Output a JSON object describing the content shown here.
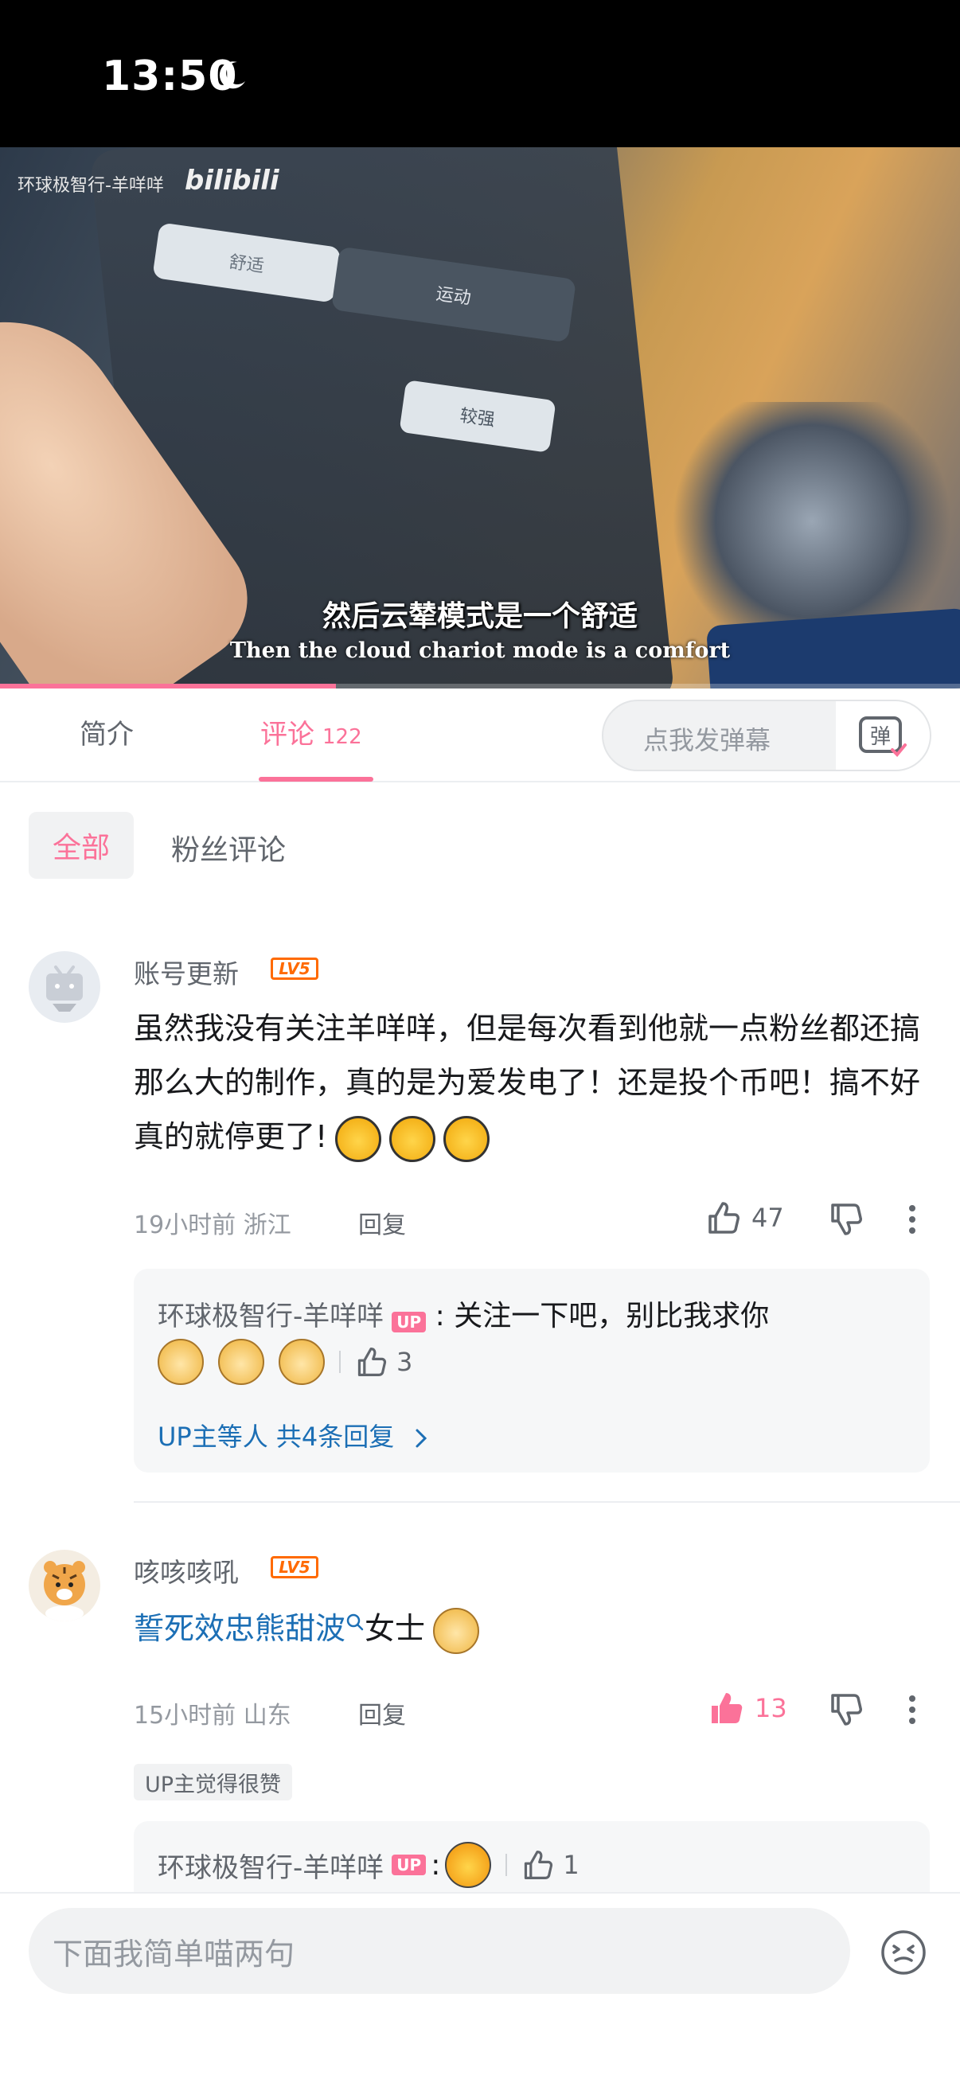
{
  "status_bar": {
    "time": "13:50"
  },
  "video": {
    "uploader_watermark": "环球极智行-羊咩咩",
    "platform_logo": "bilibili",
    "subtitle_cn": "然后云辇模式是一个舒适",
    "subtitle_en": "Then the cloud chariot mode is a comfort",
    "screen_labels": [
      "舒适",
      "运动",
      "较强"
    ],
    "progress": 0.35
  },
  "tabs": {
    "intro": "简介",
    "comments": "评论",
    "comments_count": "122",
    "danmaku_placeholder": "点我发弹幕",
    "danmaku_icon": "弹"
  },
  "filters": {
    "all": "全部",
    "fans": "粉丝评论"
  },
  "comments": [
    {
      "username": "账号更新",
      "level": "LV5",
      "text": "虽然我没有关注羊咩咩，但是每次看到他就一点粉丝都还搞那么大的制作，真的是为爱发电了！还是投个币吧！搞不好真的就停更了!",
      "time_location": "19小时前 浙江",
      "reply_label": "回复",
      "likes": "47",
      "reply": {
        "author": "环球极智行-羊咩咩",
        "tag": "UP",
        "text": "关注一下吧，别比我求你",
        "likes": "3",
        "more": "UP主等人 共4条回复"
      }
    },
    {
      "username": "咳咳咳吼",
      "level": "LV5",
      "link_text": "誓死效忠熊甜波",
      "text": "女士",
      "time_location": "15小时前 山东",
      "reply_label": "回复",
      "likes": "13",
      "up_liked": "UP主觉得很赞",
      "reply": {
        "author": "环球极智行-羊咩咩",
        "tag": "UP",
        "likes": "1"
      }
    }
  ],
  "input": {
    "placeholder": "下面我简单喵两句"
  },
  "colors": {
    "accent": "#fb7299",
    "link": "#1c6fb5",
    "level": "#ff6a00"
  }
}
